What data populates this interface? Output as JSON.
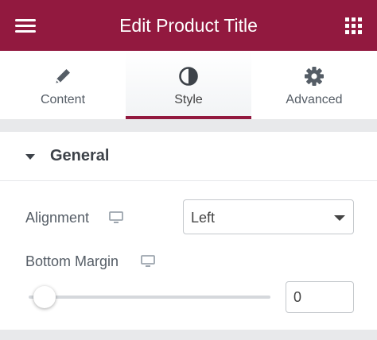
{
  "header": {
    "title": "Edit Product Title",
    "menu_icon": "hamburger-menu-icon",
    "apps_icon": "grid-apps-icon",
    "brand_color": "#92193f"
  },
  "tabs": [
    {
      "label": "Content",
      "icon": "pencil-icon",
      "active": false
    },
    {
      "label": "Style",
      "icon": "half-circle-icon",
      "active": true
    },
    {
      "label": "Advanced",
      "icon": "gear-icon",
      "active": false
    }
  ],
  "section": {
    "title": "General",
    "expanded": true,
    "caret_icon": "caret-down-icon"
  },
  "controls": {
    "alignment": {
      "label": "Alignment",
      "device_icon": "desktop-icon",
      "selected": "Left"
    },
    "bottom_margin": {
      "label": "Bottom Margin",
      "device_icon": "desktop-icon",
      "value": "0",
      "slider_fraction": 0
    }
  }
}
